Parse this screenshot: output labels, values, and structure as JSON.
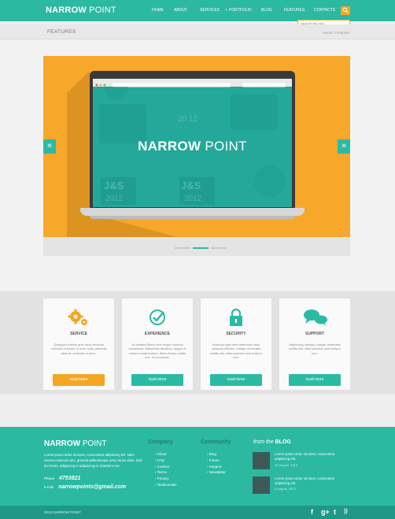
{
  "brand": {
    "bold": "NARROW",
    "light": " POINT"
  },
  "nav": [
    "HOME",
    "ABOUT",
    "SERVICES",
    "PORTFOLIO",
    "BLOG",
    "FEATURES",
    "CONTACTS"
  ],
  "nav_portfolio_marker": "+",
  "search": {
    "placeholder": "Search the site"
  },
  "page_title": "FEATURES",
  "breadcrumb": {
    "home": "Home",
    "sep": "/",
    "current": "Features"
  },
  "slider": {
    "title_bold": "NARROW",
    "title_light": " POINT",
    "prev": "«",
    "next": "»",
    "active_slide": 1,
    "screen_texts": [
      "20 12",
      "J&S",
      "J&S",
      "2012",
      "2012"
    ]
  },
  "features": [
    {
      "icon": "gears-icon",
      "title": "SERVICE",
      "text": "Quisque id tellus quis risus vehicula vehicula ut turpis. In eros nulla, placerat vitae at, vehicula ut nunc.",
      "button": "read more",
      "color": "#f5a623"
    },
    {
      "icon": "check-circle-icon",
      "title": "EXPERIENCE",
      "text": "Ut eleifend libero sed neque rhoncus consequat. Maecenas tincidunt, augue et rutrum condimentum, libero lectus mattis orci, ut commodo.",
      "button": "read more",
      "color": "#2bbba4"
    },
    {
      "icon": "lock-icon",
      "title": "SECURITY",
      "text": "Vivamus eget ante bibendum arcu vehicula ultricies. Integer venenatis mattis nisl, vitae pulvinar sem tempor non.",
      "button": "read more",
      "color": "#2bbba4"
    },
    {
      "icon": "chat-bubbles-icon",
      "title": "SUPPORT",
      "text": "Adipiscing ultricies, integer venenatis mattis nisl, vitae pulvinar sem tempor non.",
      "button": "read more",
      "color": "#2bbba4"
    }
  ],
  "footer": {
    "logo_bold": "NARROW",
    "logo_light": " POINT",
    "about": "Lorem ipsum dolor sit amet, consectetur adipiscing elit. Nam viverra euismod odio, gravida pellentesque urna varius vitae. Sed dui lorem, adipiscing in adipiscing et, interdum nec.",
    "phone_label": "Phone",
    "phone": "4753821",
    "email_label": "e-mail",
    "email": "narrowpoints@gmail.com",
    "company_heading": "Company",
    "company_links": [
      "About",
      "FAQ",
      "Contact",
      "Terms",
      "Privacy",
      "Testimonials"
    ],
    "community_heading": "Community",
    "community_links": [
      "Blog",
      "Forum",
      "Support",
      "Newsletter"
    ],
    "blog_heading_prefix": "from the ",
    "blog_heading": "BLOG",
    "posts": [
      {
        "text": "Lorem ipsum dolor sit amet, consectetur adipiscing elit.",
        "date": "26 August, 2013"
      },
      {
        "text": "Lorem ipsum dolor sit amet, consectetur adipiscing elit.",
        "date": "9 August, 2013"
      }
    ]
  },
  "copyright": "2013  NARROW POINT",
  "social": [
    {
      "icon": "facebook-icon",
      "glyph": "f"
    },
    {
      "icon": "google-plus-icon",
      "glyph": "g+"
    },
    {
      "icon": "twitter-icon",
      "glyph": "t"
    },
    {
      "icon": "rss-icon",
      "glyph": "))"
    }
  ],
  "colors": {
    "teal": "#2bb9a2",
    "orange": "#f5a623",
    "dark_teal": "#1f9888"
  }
}
